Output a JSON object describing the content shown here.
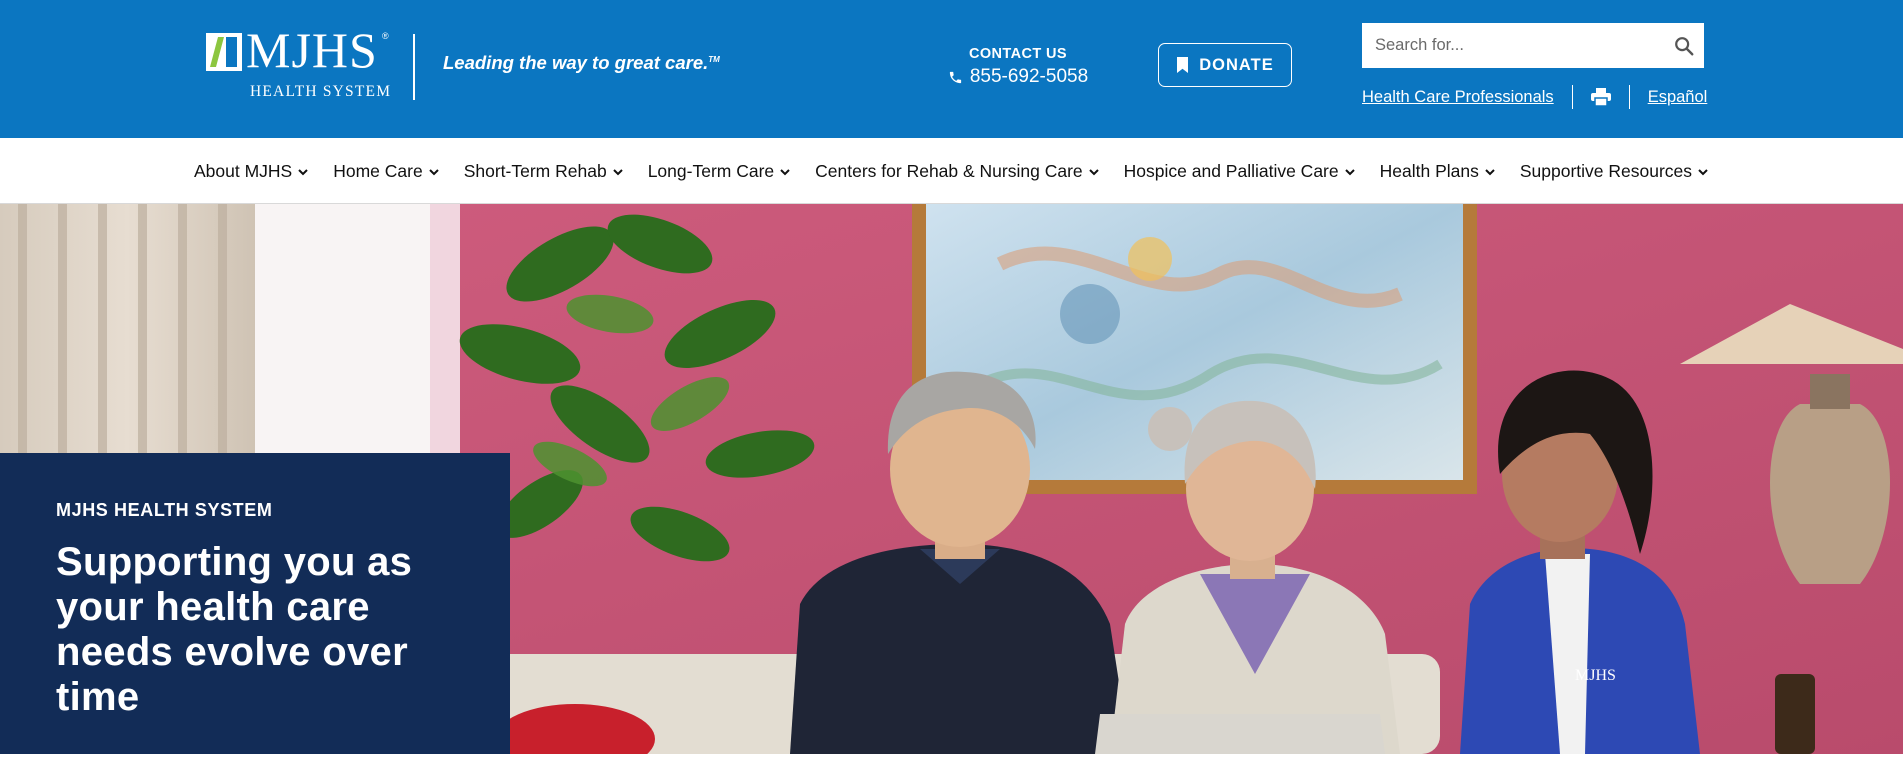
{
  "brand": {
    "logo_text": "MJHS",
    "logo_registered": "®",
    "logo_subtitle": "HEALTH SYSTEM",
    "tagline": "Leading the way to great care.",
    "tagline_mark": "TM"
  },
  "contact": {
    "label": "CONTACT US",
    "phone": "855-692-5058",
    "icon": "phone-icon"
  },
  "donate": {
    "label": "DONATE",
    "icon": "bookmark-icon"
  },
  "search": {
    "placeholder": "Search for...",
    "value": "",
    "icon": "search-icon"
  },
  "utility": {
    "professionals_link": "Health Care Professionals",
    "print_icon": "print-icon",
    "language_link": "Español"
  },
  "nav": {
    "items": [
      {
        "label": "About MJHS"
      },
      {
        "label": "Home Care"
      },
      {
        "label": "Short-Term Rehab"
      },
      {
        "label": "Long-Term Care"
      },
      {
        "label": "Centers for Rehab & Nursing Care"
      },
      {
        "label": "Hospice and Palliative Care"
      },
      {
        "label": "Health Plans"
      },
      {
        "label": "Supportive Resources"
      }
    ]
  },
  "hero": {
    "eyebrow": "MJHS HEALTH SYSTEM",
    "headline": "Supporting you as your health care needs evolve over time"
  },
  "colors": {
    "header_blue": "#0b76c1",
    "hero_card_navy": "#122c57",
    "wall_pink": "#c95778",
    "white": "#ffffff"
  }
}
